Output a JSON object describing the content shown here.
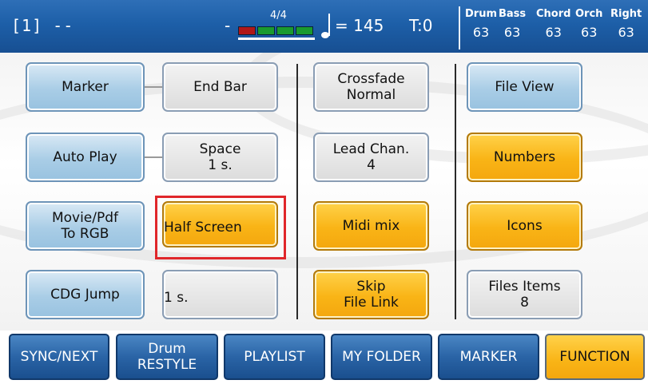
{
  "status_bar": {
    "song_position": "[1] --",
    "dash": "-",
    "time_signature": "4/4",
    "beats_indicator": [
      "red",
      "green",
      "green",
      "green"
    ],
    "tempo": "= 145",
    "transpose": "T:0",
    "mixer": [
      {
        "label": "Drum",
        "value": "63"
      },
      {
        "label": "Bass",
        "value": "63"
      },
      {
        "label": "Chord",
        "value": "63"
      },
      {
        "label": "Orch",
        "value": "63"
      },
      {
        "label": "Right",
        "value": "63"
      }
    ]
  },
  "column1": {
    "marker": "Marker",
    "auto_play": "Auto Play",
    "movie_pdf": [
      "Movie/Pdf",
      "To RGB"
    ],
    "cdg_jump": "CDG Jump"
  },
  "column2": {
    "end_bar": "End Bar",
    "space": [
      "Space",
      "1 s."
    ],
    "half_screen": "Half Screen",
    "one_sec": "1 s."
  },
  "column3": {
    "crossfade": [
      "Crossfade",
      "Normal"
    ],
    "lead_chan": [
      "Lead Chan.",
      "4"
    ],
    "midi_mix": "Midi mix",
    "skip_file_link": [
      "Skip",
      "File Link"
    ]
  },
  "column4": {
    "file_view": "File View",
    "numbers": "Numbers",
    "icons": "Icons",
    "files_items": [
      "Files Items",
      "8"
    ]
  },
  "tabs": [
    {
      "label": "SYNC/NEXT"
    },
    {
      "label": [
        "Drum",
        "RESTYLE"
      ]
    },
    {
      "label": "PLAYLIST"
    },
    {
      "label": "MY FOLDER"
    },
    {
      "label": "MARKER"
    },
    {
      "label": "FUNCTION",
      "active": true
    }
  ],
  "colors": {
    "status_bar_blue": "#1d5fa8",
    "active_orange": "#f9b416",
    "button_blue": "#a9cde6",
    "highlight_red": "#e0262a"
  }
}
